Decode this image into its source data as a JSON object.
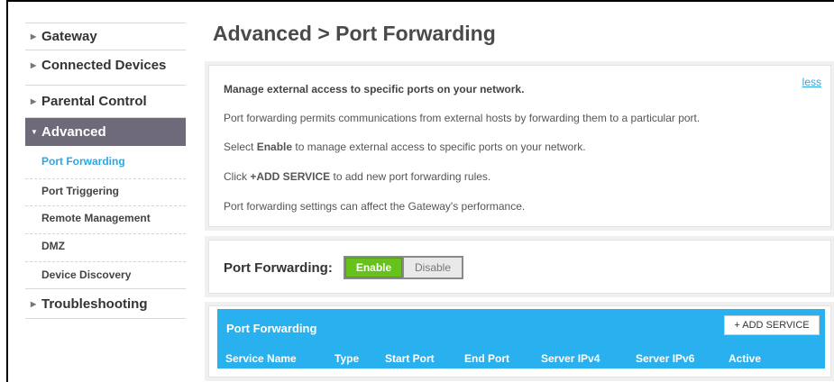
{
  "sidebar": {
    "items": [
      {
        "label": "Gateway"
      },
      {
        "label": "Connected Devices"
      },
      {
        "label": "Parental Control"
      },
      {
        "label": "Advanced"
      },
      {
        "label": "Troubleshooting"
      }
    ],
    "sub_items": [
      {
        "label": "Port Forwarding"
      },
      {
        "label": "Port Triggering"
      },
      {
        "label": "Remote Management"
      },
      {
        "label": "DMZ"
      },
      {
        "label": "Device Discovery"
      }
    ]
  },
  "main": {
    "title": "Advanced > Port Forwarding",
    "info": {
      "less_link": "less",
      "heading": "Manage external access to specific ports on your network.",
      "line1": "Port forwarding permits communications from external hosts by forwarding them to a particular port.",
      "line2_pre": "Select ",
      "line2_bold": "Enable",
      "line2_post": " to manage external access to specific ports on your network.",
      "line3_pre": "Click ",
      "line3_bold": "+ADD SERVICE",
      "line3_post": " to add new port forwarding rules.",
      "line4": "Port forwarding settings can affect the Gateway's performance."
    },
    "toggle": {
      "label": "Port Forwarding:",
      "enable": "Enable",
      "disable": "Disable",
      "state": "Enable"
    },
    "table": {
      "title": "Port Forwarding",
      "add_button": "+ ADD SERVICE",
      "columns": [
        "Service Name",
        "Type",
        "Start Port",
        "End Port",
        "Server IPv4",
        "Server IPv6",
        "Active"
      ]
    }
  },
  "colors": {
    "accent": "#29b1ef",
    "active_nav": "#6f6a7a",
    "enable_green": "#66c21a",
    "link": "#2aa8e6"
  }
}
